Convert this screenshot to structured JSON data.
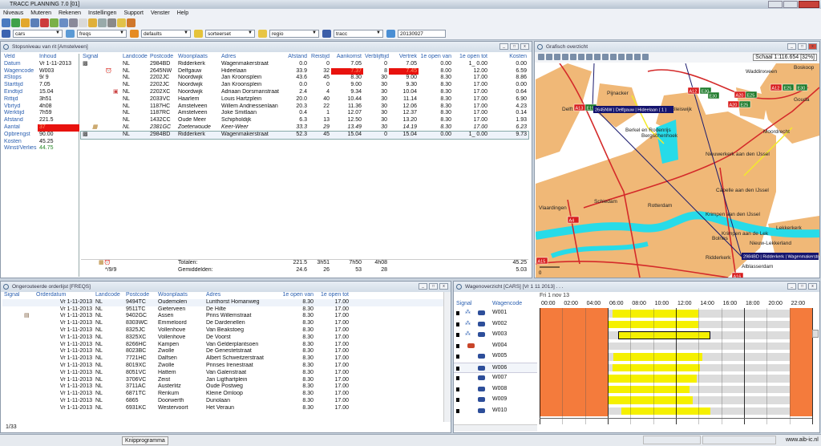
{
  "app": {
    "title": "TRACC PLANNING 7.0 [01]"
  },
  "menu": [
    "Niveaus",
    "Muteren",
    "Rekenen",
    "Instellingen",
    "Support",
    "Venster",
    "Help"
  ],
  "filters": [
    {
      "value": "cars",
      "icon": "truck-icon"
    },
    {
      "value": "freqs",
      "icon": "lock-icon"
    },
    {
      "value": "defaults",
      "icon": "gear-icon"
    },
    {
      "value": "sorteerset",
      "icon": "list-icon"
    },
    {
      "value": "regio",
      "icon": "region-icon"
    },
    {
      "value": "tracc",
      "icon": "function-icon"
    },
    {
      "value": "20130927",
      "icon": "calendar-icon"
    }
  ],
  "stops": {
    "title": "Stopsniveau van rit [Amstelveen]",
    "kv_headers": [
      "Veld",
      "Inhoud"
    ],
    "kv": [
      [
        "Datum",
        "Vr  1-11-2013"
      ],
      [
        "Wagencode",
        "W003"
      ],
      [
        "#Stops",
        "9/  9"
      ],
      [
        "Starttijd",
        "7.05"
      ],
      [
        "Eindtijd",
        "15.04"
      ],
      [
        "Rittijd",
        "3h51"
      ],
      [
        "Vbrtyd",
        "4h08"
      ],
      [
        "Werktijd",
        "7h59"
      ],
      [
        "Afstand",
        "221.5"
      ],
      [
        "Aantal",
        "37"
      ],
      [
        "Opbrengst",
        "90.00"
      ],
      [
        "Kosten",
        "45.25"
      ],
      [
        "Winst/Verlies",
        "44.75"
      ]
    ],
    "columns": [
      "Signal",
      "Landcode",
      "Postcode",
      "Woonplaats",
      "Adres",
      "Afstand",
      "Reistijd",
      "Aankomst",
      "Verblijftijd",
      "Vertrek",
      "1e open van",
      "1e open tot",
      "Kosten"
    ],
    "rows": [
      [
        "flag",
        "NL",
        "2984BD",
        "Ridderkerk",
        "Wagenmakerstraat",
        "0.0",
        "0",
        "7.05",
        "0",
        "7.05",
        "0.00",
        "1_ 0.00",
        "0.00"
      ],
      [
        "clock",
        "NL",
        "2645NW",
        "Delfgauw",
        "Hideelaan",
        "33.9",
        "32",
        "7.37",
        "8",
        "7.45",
        "8.00",
        "12.00",
        "6.59"
      ],
      [
        "",
        "NL",
        "2202JC",
        "Noordwijk",
        "Jan Kroonsplein",
        "43.6",
        "45",
        "8.30",
        "30",
        "9.00",
        "8.30",
        "17.00",
        "8.86"
      ],
      [
        "",
        "NL",
        "2202JC",
        "Noordwijk",
        "Jan Kroonsplein",
        "0.0",
        "0",
        "9.00",
        "30",
        "9.30",
        "8.30",
        "17.00",
        "0.00"
      ],
      [
        "calendar",
        "NL",
        "2202XC",
        "Noordwijk",
        "Adriaan Dorsmanstraat",
        "2.4",
        "4",
        "9.34",
        "30",
        "10.04",
        "8.30",
        "17.00",
        "0.64"
      ],
      [
        "",
        "NL",
        "2033VC",
        "Haarlem",
        "Louis Hartzplein",
        "20.0",
        "40",
        "10.44",
        "30",
        "11.14",
        "8.30",
        "17.00",
        "6.90"
      ],
      [
        "",
        "NL",
        "1187HC",
        "Amstelveen",
        "Willem Andriessenlaan",
        "20.3",
        "22",
        "11.36",
        "30",
        "12.06",
        "8.30",
        "17.00",
        "4.23"
      ],
      [
        "",
        "NL",
        "1187RC",
        "Amstelveen",
        "Joke Smitlaan",
        "0.4",
        "1",
        "12.07",
        "30",
        "12.37",
        "8.30",
        "17.00",
        "0.14"
      ],
      [
        "",
        "NL",
        "1432CC",
        "Oude Meer",
        "Schipholdijk",
        "6.3",
        "13",
        "12.50",
        "30",
        "13.20",
        "8.30",
        "17.00",
        "1.93"
      ],
      [
        "pallet",
        "NL",
        "2381GC",
        "Zoeterwoude",
        "Keer-Weer",
        "33.3",
        "29",
        "13.49",
        "30",
        "14.19",
        "8.30",
        "17.00",
        "6.23"
      ],
      [
        "flag",
        "NL",
        "2984BD",
        "Ridderkerk",
        "Wagenmakerstraat",
        "52.3",
        "45",
        "15.04",
        "0",
        "15.04",
        "0.00",
        "1_ 0.00",
        "9.73"
      ]
    ],
    "totals": {
      "label": "Totalen:",
      "afstand": "221.5",
      "reistijd": "3h51",
      "aankomst": "7h50",
      "verblijftijd": "4h08",
      "kosten": "45.25"
    },
    "averages": {
      "signal": "*/9/9",
      "label": "Gemiddelden:",
      "afstand": "24.6",
      "reistijd": "26",
      "aankomst": "53",
      "verblijftijd": "28",
      "kosten": "5.03"
    }
  },
  "map": {
    "title": "Grafisch overzicht",
    "scale": "Schaal 1:116.654 [32%]",
    "places": [
      "Delft",
      "Pijnacker",
      "Bleiswijk",
      "Waddinxveen",
      "Boskoop",
      "Gouda",
      "Berkel en Rodenrijs",
      "Bergschenhoek",
      "Moordrecht",
      "Nieuwerkerk aan den IJssel",
      "Capelle aan den IJssel",
      "Schiedam",
      "Rotterdam",
      "Vlaardingen",
      "Krimpen aan den IJssel",
      "Lekkerkerk",
      "Krimpen aan de Lek",
      "Bolnes",
      "Nieuw-Lekkerland",
      "Ridderkerk",
      "Alblasserdam"
    ],
    "roads": [
      "A12",
      "E30",
      "E30",
      "A12",
      "E25",
      "E30",
      "A13",
      "E19",
      "A20",
      "E25",
      "A20",
      "E25",
      "A4",
      "A15",
      "A16"
    ],
    "stop_labels": [
      "2645NW | Delfgauw | Hideelaan  ( 1 )",
      "2984BD | Ridderkerk | Wagenmakerstraat"
    ],
    "scalebar": "0"
  },
  "orders": {
    "title": "Ongerouteerde orderlijst [FREQS]",
    "columns": [
      "Signal",
      "Orderdatum",
      "Landcode",
      "Postcode",
      "Woonplaats",
      "Adres",
      "1e open van",
      "1e open tot"
    ],
    "rows": [
      [
        "",
        "Vr  1-11-2013",
        "NL",
        "9494TC",
        "Oudemolen",
        "Lunthorst Homanweg",
        "8.30",
        "17.00"
      ],
      [
        "",
        "Vr  1-11-2013",
        "NL",
        "9511TC",
        "Gieterveen",
        "De Hilte",
        "8.30",
        "17.00"
      ],
      [
        "box",
        "Vr  1-11-2013",
        "NL",
        "9402GC",
        "Assen",
        "Prins Willemstraat",
        "8.30",
        "17.00"
      ],
      [
        "",
        "Vr  1-11-2013",
        "NL",
        "8303WC",
        "Emmeloord",
        "De Dardenellen",
        "8.30",
        "17.00"
      ],
      [
        "",
        "Vr  1-11-2013",
        "NL",
        "8325JC",
        "Vollenhove",
        "Van Beakstoeg",
        "8.30",
        "17.00"
      ],
      [
        "",
        "Vr  1-11-2013",
        "NL",
        "8325XC",
        "Vollenhove",
        "De Voorst",
        "8.30",
        "17.00"
      ],
      [
        "",
        "Vr  1-11-2013",
        "NL",
        "8266HC",
        "Kampen",
        "Van Gelderplantsoen",
        "8.30",
        "17.00"
      ],
      [
        "",
        "Vr  1-11-2013",
        "NL",
        "8023BC",
        "Zwolle",
        "De Genestetstraat",
        "8.30",
        "17.00"
      ],
      [
        "",
        "Vr  1-11-2013",
        "NL",
        "7721HC",
        "Dalfsen",
        "Albert Schweitzerstraat",
        "8.30",
        "17.00"
      ],
      [
        "",
        "Vr  1-11-2013",
        "NL",
        "8019XC",
        "Zwolle",
        "Prinses Irenestraat",
        "8.30",
        "17.00"
      ],
      [
        "",
        "Vr  1-11-2013",
        "NL",
        "8051VC",
        "Hattem",
        "Van Galenstraat",
        "8.30",
        "17.00"
      ],
      [
        "",
        "Vr  1-11-2013",
        "NL",
        "3706VC",
        "Zeist",
        "Jan Ligthartplein",
        "8.30",
        "17.00"
      ],
      [
        "",
        "Vr  1-11-2013",
        "NL",
        "3711AC",
        "Austerlitz",
        "Oude Postweg",
        "8.30",
        "17.00"
      ],
      [
        "",
        "Vr  1-11-2013",
        "NL",
        "6871TC",
        "Renkum",
        "Kleine Omloop",
        "8.30",
        "17.00"
      ],
      [
        "",
        "Vr  1-11-2013",
        "NL",
        "6865",
        "Doorwerth",
        "Dunolaan",
        "8.30",
        "17.00"
      ],
      [
        "",
        "Vr  1-11-2013",
        "NL",
        "6931KC",
        "Westervoort",
        "Het Veraun",
        "8.30",
        "17.00"
      ]
    ],
    "footer": "1/33"
  },
  "wagens": {
    "title": "Wagenoverzicht [CARS] [Vr 1 11 2013] . . .",
    "date": "Fri 1 nov 13",
    "columns": [
      "Signal",
      "Wagencode"
    ],
    "hours": [
      "00:00",
      "02:00",
      "04:00",
      "06:00",
      "08:00",
      "10:00",
      "12:00",
      "14:00",
      "16:00",
      "18:00",
      "20:00",
      "22:00"
    ],
    "offhours": [
      [
        0,
        6
      ],
      [
        22,
        24
      ]
    ],
    "rows": [
      {
        "code": "W001",
        "start": 6.4,
        "end": 14.0
      },
      {
        "code": "W002",
        "start": 6.0,
        "end": 14.0
      },
      {
        "code": "W003",
        "start": 6.9,
        "end": 15.0,
        "selected": true
      },
      {
        "code": "W004",
        "start": null,
        "end": null
      },
      {
        "code": "W005",
        "start": 6.5,
        "end": 14.3
      },
      {
        "code": "W006",
        "start": 6.4,
        "end": 14.1
      },
      {
        "code": "W007",
        "start": 6.0,
        "end": 13.8
      },
      {
        "code": "W008",
        "start": 6.0,
        "end": 13.2
      },
      {
        "code": "W009",
        "start": 6.0,
        "end": 13.5
      },
      {
        "code": "W010",
        "start": 7.2,
        "end": 15.0
      }
    ],
    "colors": {
      "offhours": "#f47b3c",
      "bar": "#f5f000",
      "band": "#dcdcdc"
    }
  },
  "status": {
    "clipboard": "Knipprogramma",
    "website": "www.aib-ic.nl"
  }
}
